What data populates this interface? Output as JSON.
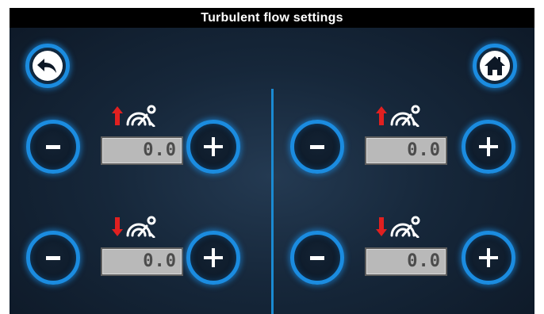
{
  "header": {
    "title": "Turbulent flow settings"
  },
  "nav": {
    "back_icon": "back-arrow-icon",
    "home_icon": "home-icon"
  },
  "controls": [
    {
      "id": "left-upper",
      "direction": "up",
      "value": "0.0"
    },
    {
      "id": "left-lower",
      "direction": "down",
      "value": "0.0"
    },
    {
      "id": "right-upper",
      "direction": "up",
      "value": "0.0"
    },
    {
      "id": "right-lower",
      "direction": "down",
      "value": "0.0"
    }
  ],
  "colors": {
    "accent": "#1b8ce0",
    "arrow": "#e02020",
    "background": "#16273a",
    "lcd": "#b9b9b9"
  }
}
